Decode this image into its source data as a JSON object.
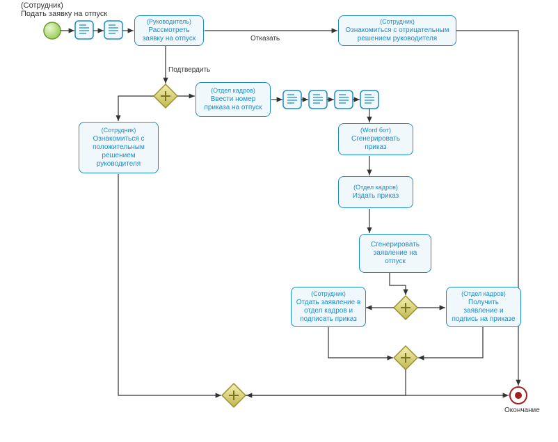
{
  "title_performer": "(Сотрудник)",
  "title_task": "Подать заявку на отпуск",
  "nodes": {
    "n1": {
      "performer": "(Руководитель)",
      "task": "Рассмотреть заявку на отпуск"
    },
    "n2": {
      "performer": "(Сотрудник)",
      "task": "Ознакомиться с отрицательным решением руководителя"
    },
    "n3": {
      "performer": "(Отдел кадров)",
      "task": "Ввести номер приказа на отпуск"
    },
    "n4": {
      "performer": "(Сотрудник)",
      "task": "Ознакомиться с положительным решением руководителя"
    },
    "n5": {
      "performer": "(Word бот)",
      "task": "Сгенерировать приказ"
    },
    "n6": {
      "performer": "(Отдел кадров)",
      "task": "Издать приказ"
    },
    "n7": {
      "performer": "",
      "task": "Сгенерировать заявление на отпуск"
    },
    "n8": {
      "performer": "(Сотрудник)",
      "task": "Отдать заявление в отдел кадров и подписать приказ"
    },
    "n9": {
      "performer": "(Отдел кадров)",
      "task": "Получить заявление и подпись на приказе"
    }
  },
  "labels": {
    "reject": "Отказать",
    "confirm": "Подтвердить",
    "end": "Окончание"
  }
}
